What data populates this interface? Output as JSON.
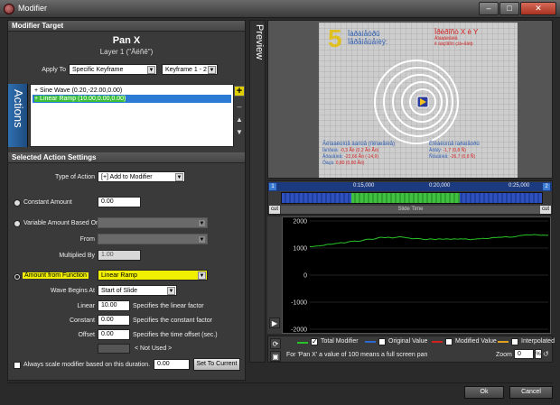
{
  "window": {
    "title": "Modifier",
    "minimize": "–",
    "maximize": "□",
    "close": "✕"
  },
  "modifier_target": {
    "header": "Modifier Target",
    "title": "Pan X",
    "subtitle": "Layer 1 (\"Äëñê\")",
    "apply_to_label": "Apply To",
    "apply_to_value": "Specific Keyframe",
    "keyframe_value": "Keyframe 1 - 2"
  },
  "actions": {
    "tab_label": "Actions",
    "items": [
      {
        "prefix": "+ ",
        "label": "Sine Wave (0.20,-22.00,0.00)"
      },
      {
        "prefix": "+ ",
        "label": "Linear Ramp (10.00,0.00,0.00)"
      }
    ],
    "add": "+",
    "remove": "–",
    "up": "▲",
    "down": "▼"
  },
  "settings": {
    "header": "Selected Action Settings",
    "type_label": "Type of Action",
    "type_value": "[+] Add to Modifier",
    "constant_amount_label": "Constant Amount",
    "constant_amount_value": "0.00",
    "variable_label": "Variable Amount Based On",
    "variable_value": "",
    "from_label": "From",
    "from_value": "",
    "multiplied_label": "Multiplied By",
    "multiplied_value": "1.00",
    "function_label": "Amount from Function",
    "function_value": "Linear Ramp",
    "wave_label": "Wave Begins At",
    "wave_value": "Start of Slide",
    "linear_label": "Linear",
    "linear_value": "10.00",
    "linear_desc": "Specifies the linear factor",
    "constant_label": "Constant",
    "constant_value": "0.00",
    "constant_desc": "Specifies the constant factor",
    "offset_label": "Offset",
    "offset_value": "0.00",
    "offset_desc": "Specifies the time offset (sec.)",
    "not_used": "< Not Used >",
    "always_scale_label": "Always scale modifier based on this duration.",
    "duration_value": "0.00",
    "set_current": "Set To Current"
  },
  "preview": {
    "tab_label": "Preview",
    "big_number": "5",
    "header_text_1": "Ïàðàìåòðû",
    "header_text_2": "Ïåðåìåùåíèÿ:",
    "red_title": "Ïðèðîñò X è Y",
    "red_sub_1": "Äîáàâëåíèå",
    "red_sub_2": "ê áàçîâîìó çíà÷åíèþ",
    "blue_left_title": "Ãëîáàëüíûå äàííûå (ïîëîæåíèå)",
    "blue_left_rows": [
      {
        "k": "Ïàíîðàìà:",
        "v": "-0,3 Ãö (0,2 Ãö Ãö)"
      },
      {
        "k": "Âðàùåíèå:",
        "v": "-22,66 Ãö (-14,9)"
      },
      {
        "k": "Ôàçà:",
        "v": "0,80 (0,80 Ãö)"
      }
    ],
    "blue_right_title": "Ëîêàëüíûå ïàðàìåòðû",
    "blue_right_rows": [
      {
        "k": "Âðåìÿ:",
        "v": "-1,7 (0,8 Ñ)"
      },
      {
        "k": "Ñìåùåíèå:",
        "v": "-26,7 (0,8 Ñ)"
      }
    ]
  },
  "timeline": {
    "marker_start": "1",
    "marker_end": "2",
    "times": [
      "0:15,000",
      "0:20,000",
      "0:25,000"
    ],
    "cut_left": "cut",
    "cut_right": "cut",
    "slide_time": "Slide Time"
  },
  "graph": {
    "yticks": [
      "2000",
      "1000",
      "0",
      "-1000",
      "-2000"
    ],
    "line_color": "#27c427",
    "chart_data": {
      "type": "line",
      "ylim": [
        -2000,
        2000
      ],
      "series": [
        {
          "name": "Total Modifier",
          "values": [
            1060,
            1050,
            1065,
            1075,
            1080,
            1090,
            1100,
            1130,
            1140,
            1135,
            1150,
            1170,
            1180,
            1200,
            1190,
            1195,
            1220,
            1240,
            1250,
            1260,
            1245,
            1250,
            1270,
            1300,
            1320,
            1330,
            1320,
            1325,
            1350,
            1380,
            1400,
            1390,
            1380,
            1400,
            1390,
            1370,
            1385,
            1400,
            1420,
            1410,
            1395,
            1380,
            1370,
            1350,
            1340,
            1355,
            1350,
            1345,
            1320,
            1310,
            1320,
            1340,
            1330,
            1310,
            1330,
            1340,
            1325,
            1330,
            1340,
            1330,
            1320,
            1340,
            1335,
            1330,
            1340,
            1335,
            1340,
            1320,
            1310,
            1325,
            1330,
            1345,
            1340,
            1360,
            1355,
            1350,
            1360,
            1380,
            1390,
            1385,
            1400,
            1395,
            1410,
            1420,
            1410,
            1400,
            1405,
            1420,
            1440,
            1460,
            1470,
            1480,
            1490,
            1480,
            1485,
            1500,
            1490,
            1480,
            1470,
            1480,
            1470,
            1475
          ]
        }
      ]
    }
  },
  "legend": {
    "total": "Total Modifier",
    "original": "Original Value",
    "modified": "Modified Value",
    "interpolated": "Interpolated",
    "note": "For 'Pan X' a value of 100 means a full screen pan",
    "zoom_label": "Zoom",
    "zoom_value": "0",
    "zoom_unit": "%"
  },
  "footer": {
    "ok": "Ok",
    "cancel": "Cancel"
  }
}
